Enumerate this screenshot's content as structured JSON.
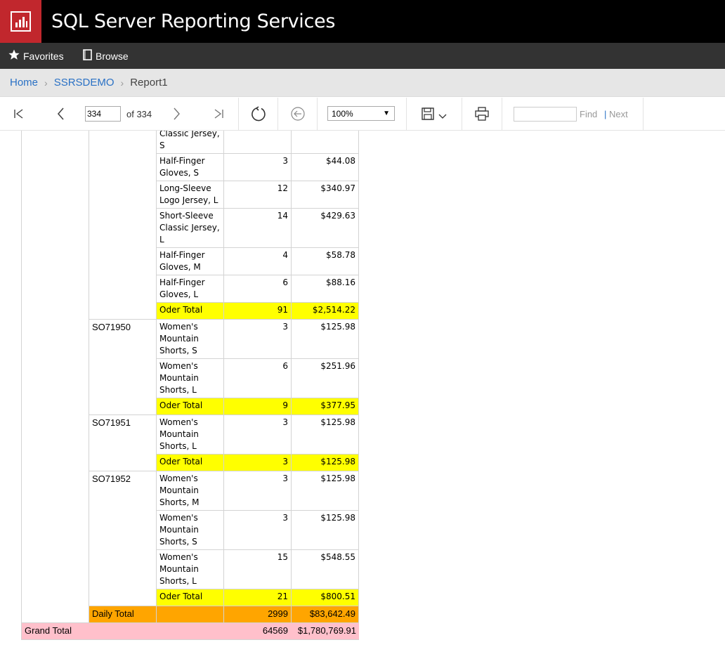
{
  "app": {
    "title": "SQL Server Reporting Services"
  },
  "nav": {
    "favorites": "Favorites",
    "browse": "Browse"
  },
  "breadcrumb": {
    "home": "Home",
    "folder": "SSRSDEMO",
    "report": "Report1"
  },
  "toolbar": {
    "page_value": "334",
    "page_of": "of 334",
    "zoom": "100%",
    "find_value": "",
    "find": "Find",
    "next": "Next",
    "separator": "|"
  },
  "report": {
    "rows": [
      {
        "product": "Classic Jersey,\nS",
        "qty": "",
        "amount": ""
      },
      {
        "product": "Half-Finger\nGloves, S",
        "qty": "3",
        "amount": "$44.08"
      },
      {
        "product": "Long-Sleeve\nLogo Jersey, L",
        "qty": "12",
        "amount": "$340.97"
      },
      {
        "product": "Short-Sleeve\nClassic Jersey,\nL",
        "qty": "14",
        "amount": "$429.63"
      },
      {
        "product": "Half-Finger\nGloves, M",
        "qty": "4",
        "amount": "$58.78"
      },
      {
        "product": "Half-Finger\nGloves, L",
        "qty": "6",
        "amount": "$88.16"
      },
      {
        "product": "Oder Total",
        "qty": "91",
        "amount": "$2,514.22",
        "total": true
      },
      {
        "order": "SO71950",
        "product": "Women's\nMountain\nShorts, S",
        "qty": "3",
        "amount": "$125.98"
      },
      {
        "product": "Women's\nMountain\nShorts, L",
        "qty": "6",
        "amount": "$251.96"
      },
      {
        "product": "Oder Total",
        "qty": "9",
        "amount": "$377.95",
        "total": true
      },
      {
        "order": "SO71951",
        "product": "Women's\nMountain\nShorts, L",
        "qty": "3",
        "amount": "$125.98"
      },
      {
        "product": "Oder Total",
        "qty": "3",
        "amount": "$125.98",
        "total": true
      },
      {
        "order": "SO71952",
        "product": "Women's\nMountain\nShorts, M",
        "qty": "3",
        "amount": "$125.98"
      },
      {
        "product": "Women's\nMountain\nShorts, S",
        "qty": "3",
        "amount": "$125.98"
      },
      {
        "product": "Women's\nMountain\nShorts, L",
        "qty": "15",
        "amount": "$548.55"
      },
      {
        "product": "Oder Total",
        "qty": "21",
        "amount": "$800.51",
        "total": true
      }
    ],
    "daily_total": {
      "label": "Daily Total",
      "qty": "2999",
      "amount": "$83,642.49"
    },
    "grand_total": {
      "label": "Grand Total",
      "qty": "64569",
      "amount": "$1,780,769.91"
    }
  },
  "colors": {
    "logo": "#c1272d",
    "order_total": "#ffff00",
    "daily_total": "#ffa500",
    "grand_total": "#ffc0cb",
    "link": "#2a71c5"
  }
}
